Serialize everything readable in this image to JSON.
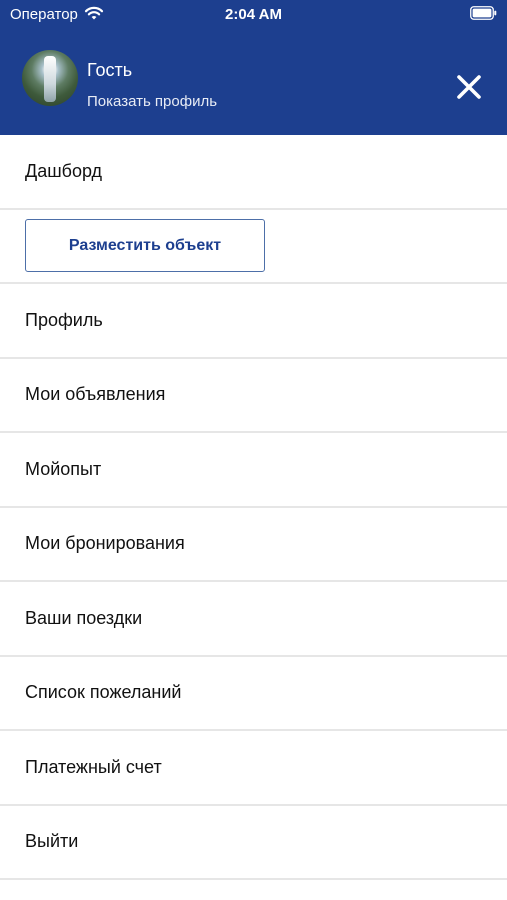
{
  "status_bar": {
    "carrier": "Оператор",
    "time": "2:04 AM"
  },
  "header": {
    "user_name": "Гость",
    "profile_link": "Показать профиль",
    "close_icon": "close-icon",
    "background_color": "#1d3f8f"
  },
  "menu": {
    "dashboard": "Дашборд",
    "place_button": "Разместить объект",
    "items": [
      "Профиль",
      "Мои объявления",
      "Мойопыт",
      "Мои бронирования",
      "Ваши поездки",
      "Список пожеланий",
      "Платежный счет",
      "Выйти"
    ]
  }
}
